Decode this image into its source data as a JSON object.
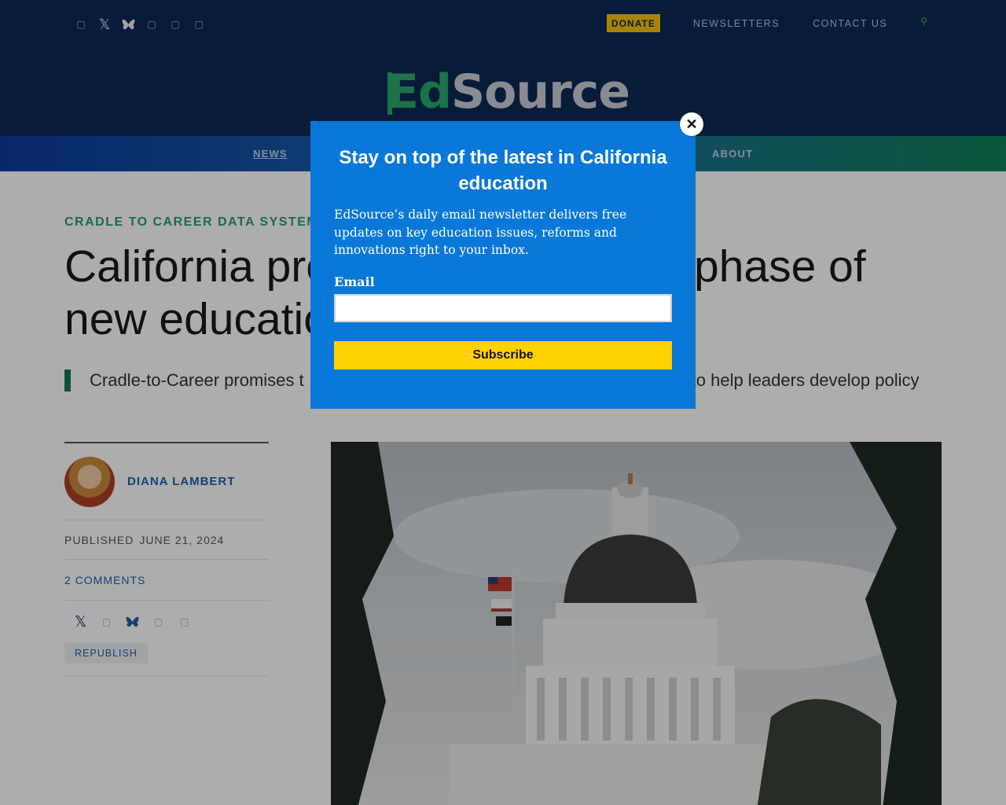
{
  "header": {
    "social_icons": [
      "facebook-icon",
      "x-icon",
      "bluesky-icon",
      "instagram-icon",
      "linkedin-icon",
      "youtube-icon"
    ],
    "donate_label": "DONATE",
    "newsletters_label": "NEWSLETTERS",
    "contact_label": "CONTACT US",
    "search_icon": "search-icon",
    "logo_ed": "Ed",
    "logo_source": "Source"
  },
  "nav": {
    "items": [
      {
        "label": "NEWS"
      },
      {
        "label": "ABOUT"
      }
    ]
  },
  "article": {
    "kicker": "CRADLE TO CAREER DATA SYSTEM",
    "headline": "California pre                                   phase of new educatio",
    "headline_left_1": "California pre",
    "headline_right_1": "phase of",
    "headline_left_2": "new educatio",
    "dek_left": "Cradle-to-Career promises t",
    "dek_right": "to help leaders develop policy",
    "author": "DIANA LAMBERT",
    "published_label": "PUBLISHED",
    "published_date": "JUNE 21, 2024",
    "comments": "2 COMMENTS",
    "republish": "REPUBLISH"
  },
  "modal": {
    "title": "Stay on top of the latest in California education",
    "text": "EdSource’s daily email newsletter delivers free updates on key education issues, reforms and innovations right to your inbox.",
    "email_label": "Email",
    "email_value": "",
    "subscribe_label": "Subscribe",
    "close_glyph": "✕"
  },
  "colors": {
    "header_bg": "#0c2a55",
    "accent_green": "#2aaa6e",
    "modal_bg": "#0a78d8",
    "subscribe_bg": "#ffd200",
    "donate_bg": "#f5c400"
  }
}
